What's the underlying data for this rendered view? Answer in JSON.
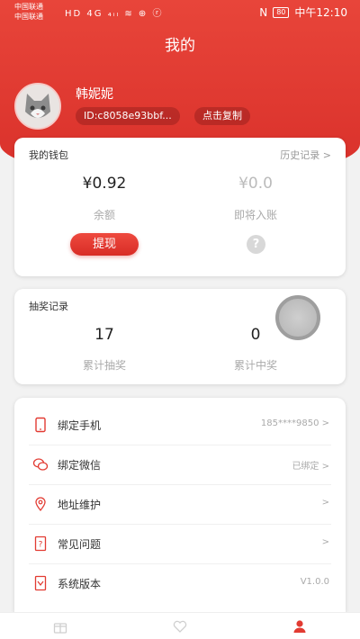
{
  "status_bar": {
    "carrier_1": "中国联通",
    "carrier_2": "中国联通",
    "icons": "HD 4G ₄ᵢₗ ≋ ⊕ ⓡ",
    "nfc": "N",
    "battery": "80",
    "time": "中午12:10"
  },
  "header": {
    "title": "我的"
  },
  "profile": {
    "name": "韩妮妮",
    "id_text": "ID:c8058e93bbf...",
    "copy_label": "点击复制"
  },
  "wallet": {
    "title": "我的钱包",
    "history_link": "历史记录 >",
    "balance_value": "¥0.92",
    "balance_label": "余额",
    "pending_value": "¥0.0",
    "pending_label": "即将入账",
    "withdraw_label": "提现",
    "help_glyph": "?"
  },
  "lottery": {
    "title": "抽奖记录",
    "total_draws_value": "17",
    "total_draws_label": "累计抽奖",
    "total_wins_value": "0",
    "total_wins_label": "累计中奖"
  },
  "menu": {
    "items": [
      {
        "label": "绑定手机",
        "value": "185****9850 >",
        "icon": "phone-icon"
      },
      {
        "label": "绑定微信",
        "value": "已绑定 >",
        "icon": "wechat-icon"
      },
      {
        "label": "地址维护",
        "value": ">",
        "icon": "location-icon"
      },
      {
        "label": "常见问题",
        "value": ">",
        "icon": "question-doc-icon"
      },
      {
        "label": "系统版本",
        "value": "V1.0.0",
        "icon": "version-doc-icon"
      }
    ]
  },
  "tabbar": {
    "tabs": [
      {
        "icon": "gift-icon",
        "active": false
      },
      {
        "icon": "heart-icon",
        "active": false
      },
      {
        "icon": "user-icon",
        "active": true
      }
    ]
  },
  "colors": {
    "accent": "#e23b32",
    "muted": "#aaaaaa",
    "background": "#f2f2f2"
  }
}
